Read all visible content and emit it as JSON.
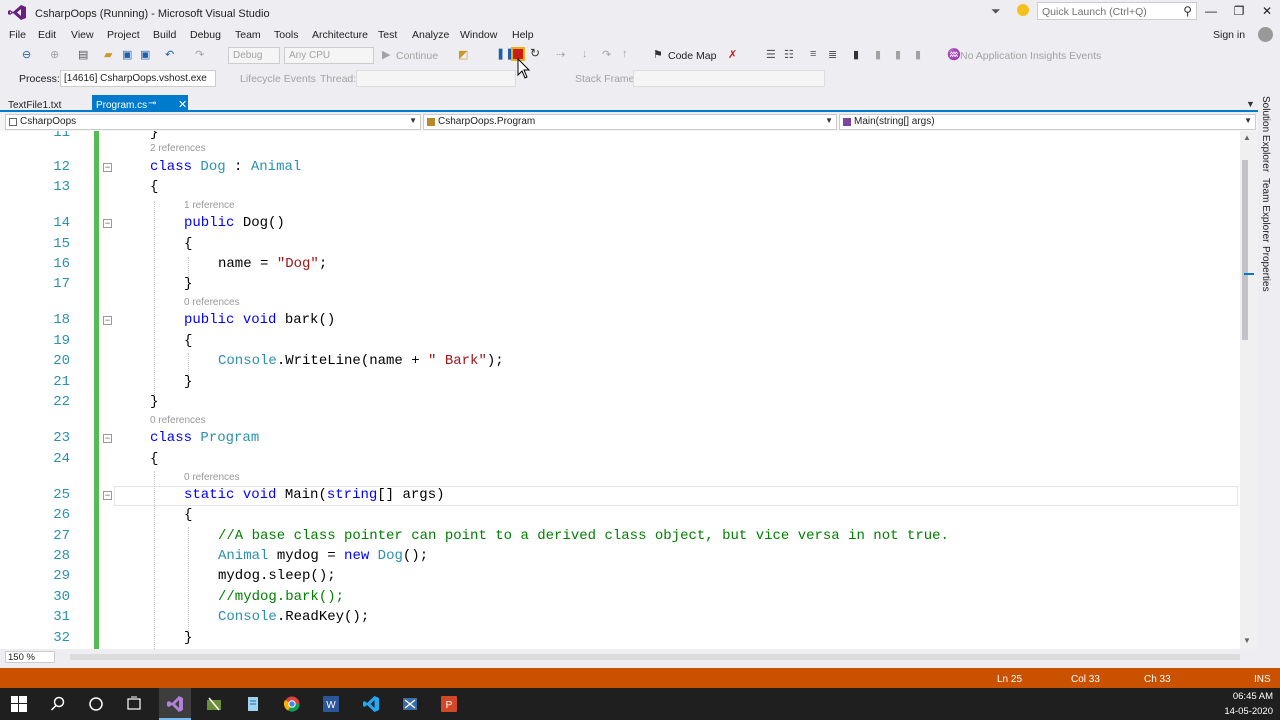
{
  "window": {
    "title": "CsharpOops (Running) - Microsoft Visual Studio",
    "quick_launch_placeholder": "Quick Launch (Ctrl+Q)",
    "sign_in": "Sign in"
  },
  "menu": [
    "File",
    "Edit",
    "View",
    "Project",
    "Build",
    "Debug",
    "Team",
    "Tools",
    "Architecture",
    "Test",
    "Analyze",
    "Window",
    "Help"
  ],
  "toolbar": {
    "config": "Debug",
    "platform": "Any CPU",
    "continue": "Continue",
    "code_map": "Code Map",
    "app_insights": "No Application Insights Events"
  },
  "debug_toolbar": {
    "process_label": "Process:",
    "process_value": "[14616] CsharpOops.vshost.exe",
    "lifecycle": "Lifecycle Events",
    "thread_label": "Thread:",
    "stack_frame_label": "Stack Frame:"
  },
  "tabs": [
    {
      "label": "TextFile1.txt",
      "active": false
    },
    {
      "label": "Program.cs",
      "active": true
    }
  ],
  "navbar": {
    "project": "CsharpOops",
    "type": "CsharpOops.Program",
    "member": "Main(string[] args)"
  },
  "side_tabs": [
    "Solution Explorer",
    "Team Explorer",
    "Properties"
  ],
  "editor": {
    "partial_line_number": "11",
    "lenses": {
      "dog_class": "2 references",
      "dog_ctor": "1 reference",
      "bark": "0 references",
      "program_class": "0 references",
      "main": "0 references"
    },
    "line_numbers": [
      "12",
      "13",
      "14",
      "15",
      "16",
      "17",
      "18",
      "19",
      "20",
      "21",
      "22",
      "23",
      "24",
      "25",
      "26",
      "27",
      "28",
      "29",
      "30",
      "31",
      "32"
    ],
    "tokens": {
      "class": "class",
      "Dog": "Dog",
      "colon": " : ",
      "Animal": "Animal",
      "brace_open": "{",
      "brace_close": "}",
      "public": "public",
      "dog_ctor": " Dog()",
      "name_assign": "name = ",
      "dog_string": "\"Dog\"",
      "semicolon": ";",
      "void": "void",
      "bark_sig": " bark()",
      "Console": "Console",
      "writeline": ".WriteLine(name + ",
      "bark_string": "\" Bark\"",
      "writeline_end": ");",
      "Program": "Program",
      "static": "static",
      "main_name": " Main(",
      "string_kw": "string",
      "main_args": "[] args)",
      "comment1": "//A base class pointer can point to a derived class object, but vice versa in not true.",
      "mydog_decl": " mydog = ",
      "new": "new",
      "dog_new_end": "();",
      "sleep_call": "mydog.sleep();",
      "comment2": "//mydog.bark();",
      "readkey": ".ReadKey();"
    }
  },
  "status": {
    "zoom": "150 %",
    "ln": "Ln 25",
    "col": "Col 33",
    "ch": "Ch 33",
    "mode": "INS"
  },
  "taskbar": {
    "time": "06:45 AM",
    "date": "14-05-2020"
  },
  "colors": {
    "accent": "#007acc",
    "status_bar": "#ca5100",
    "keyword": "#0000ff",
    "type": "#2b91af",
    "string": "#a31515",
    "comment": "#008000"
  }
}
